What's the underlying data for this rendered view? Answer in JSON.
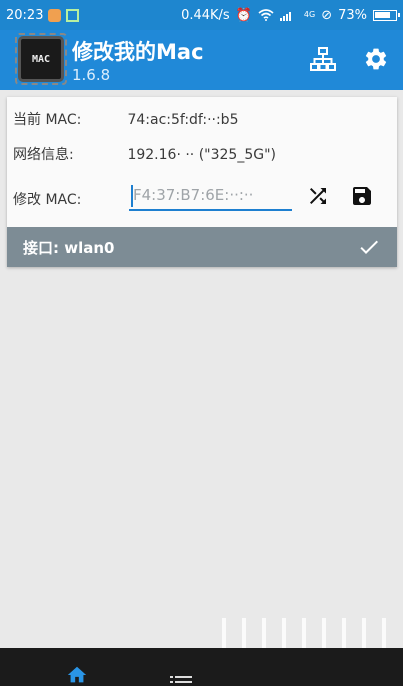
{
  "status_bar": {
    "time": "20:23",
    "speed": "0.44K/s",
    "network": "4G",
    "battery": "73%"
  },
  "app_bar": {
    "title": "修改我的Mac",
    "version": "1.6.8",
    "logo_text": "MAC"
  },
  "card": {
    "current_mac_label": "当前 MAC:",
    "current_mac_value": "74:ac:5f:df:··:b5",
    "network_info_label": "网络信息:",
    "network_info_value": "192.16· ·· (\"325_5G\")",
    "modify_mac_label": "修改 MAC:",
    "modify_mac_value": "F4:37:B7:6E:··:··"
  },
  "interface_bar": {
    "label": "接口: wlan0"
  },
  "colors": {
    "primary": "#2089d8",
    "status": "#1e86cf",
    "accent": "#1d7fd0",
    "interface_bar": "#7d8c95"
  },
  "icons": {
    "network": "network-tree-icon",
    "settings": "gear-icon",
    "shuffle": "shuffle-icon",
    "save": "save-icon",
    "check": "check-icon",
    "home": "home-icon",
    "list": "list-icon"
  }
}
